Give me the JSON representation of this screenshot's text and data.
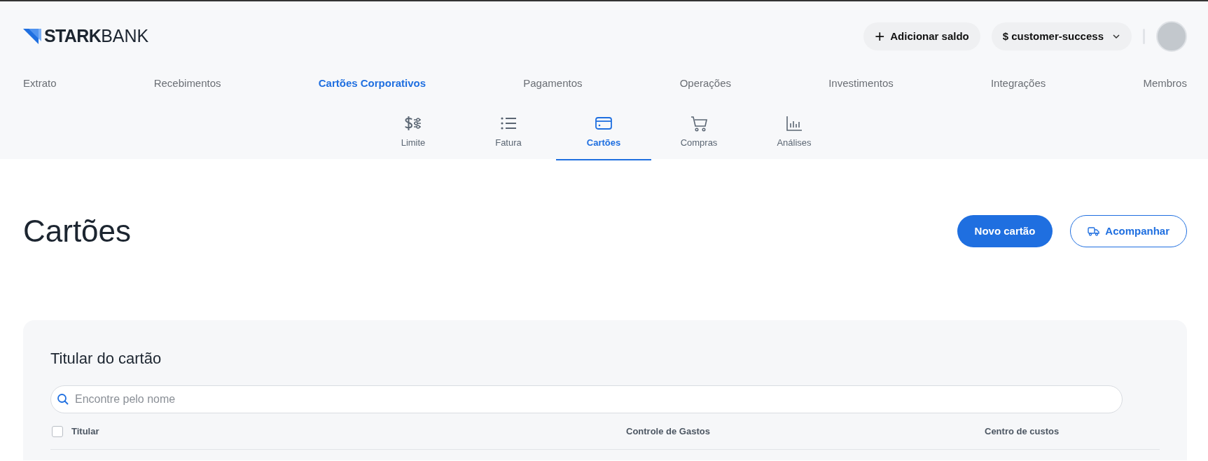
{
  "logo": {
    "bold": "STARK",
    "light": "BANK"
  },
  "header_actions": {
    "add_balance": {
      "icon": "+",
      "label": "Adicionar saldo"
    },
    "workspace": "$ customer-success"
  },
  "main_nav": [
    {
      "label": "Extrato",
      "selected": false
    },
    {
      "label": "Recebimentos",
      "selected": false
    },
    {
      "label": "Cartões Corporativos",
      "selected": true
    },
    {
      "label": "Pagamentos",
      "selected": false
    },
    {
      "label": "Operações",
      "selected": false
    },
    {
      "label": "Investimentos",
      "selected": false
    },
    {
      "label": "Integrações",
      "selected": false
    },
    {
      "label": "Membros",
      "selected": false
    }
  ],
  "sub_nav": [
    {
      "kind": "limit",
      "label": "Limite",
      "selected": false
    },
    {
      "kind": "list",
      "label": "Fatura",
      "selected": false
    },
    {
      "kind": "card",
      "label": "Cartões",
      "selected": true
    },
    {
      "kind": "cart",
      "label": "Compras",
      "selected": false
    },
    {
      "kind": "chart",
      "label": "Análises",
      "selected": false
    }
  ],
  "page": {
    "title": "Cartões",
    "buttons": [
      {
        "kind": "primary",
        "label": "Novo cartão"
      },
      {
        "kind": "outline",
        "label": "Acompanhar"
      }
    ]
  },
  "panel": {
    "title": "Titular do cartão",
    "search": {
      "placeholder": "Encontre pelo nome"
    },
    "select_all": {
      "checked": false
    },
    "columns": [
      "Titular",
      "Controle de Gastos",
      "Centro de custos"
    ]
  }
}
